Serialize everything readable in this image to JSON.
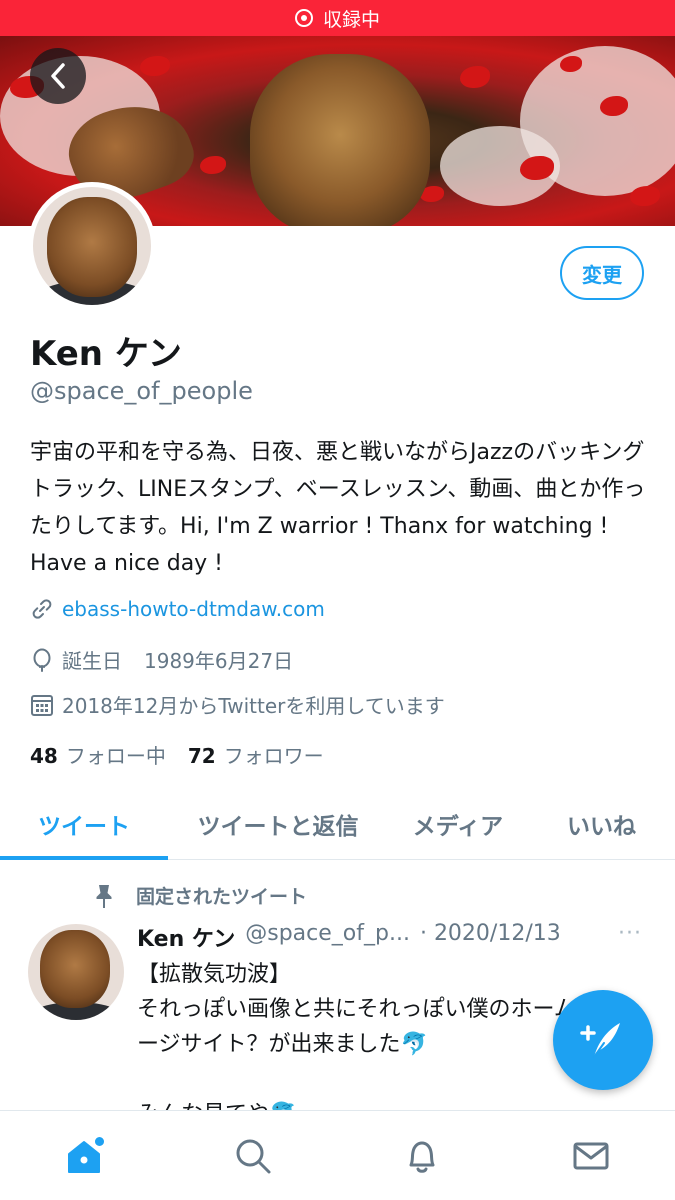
{
  "status_bar": {
    "recording_label": "収録中"
  },
  "header": {
    "back_icon": "chevron-left-icon"
  },
  "profile": {
    "edit_label": "変更",
    "display_name": "Ken ケン",
    "handle": "@space_of_people",
    "bio": "宇宙の平和を守る為、日夜、悪と戦いながらJazzのバッキングトラック、LINEスタンプ、ベースレッスン、動画、曲とか作ったりしてます。Hi, I'm Z warrior ! Thanx for watching ! Have a nice day !",
    "website": "ebass-howto-dtmdaw.com",
    "birthday_label": "誕生日",
    "birthday": "1989年6月27日",
    "joined": "2018年12月からTwitterを利用しています",
    "following_count": "48",
    "following_label": "フォロー中",
    "followers_count": "72",
    "followers_label": "フォロワー"
  },
  "tabs": [
    {
      "label": "ツイート",
      "active": true
    },
    {
      "label": "ツイートと返信",
      "active": false
    },
    {
      "label": "メディア",
      "active": false
    },
    {
      "label": "いいね",
      "active": false
    }
  ],
  "tweet": {
    "pinned_label": "固定されたツイート",
    "author_name": "Ken ケン",
    "author_handle": "@space_of_p...",
    "date": "· 2020/12/13",
    "more": "···",
    "text": "【拡散気功波】\nそれっぽい画像と共にそれっぽい僕のホームページサイト？が出来ました🐬\n\nみんな見てや🐬"
  },
  "bottom_nav": [
    {
      "name": "home",
      "icon": "home-icon",
      "active": true
    },
    {
      "name": "search",
      "icon": "search-icon",
      "active": false
    },
    {
      "name": "notifications",
      "icon": "bell-icon",
      "active": false
    },
    {
      "name": "messages",
      "icon": "mail-icon",
      "active": false
    }
  ],
  "colors": {
    "accent": "#1da1f2",
    "recording": "#fa2438",
    "muted": "#657786",
    "text": "#14171a"
  }
}
